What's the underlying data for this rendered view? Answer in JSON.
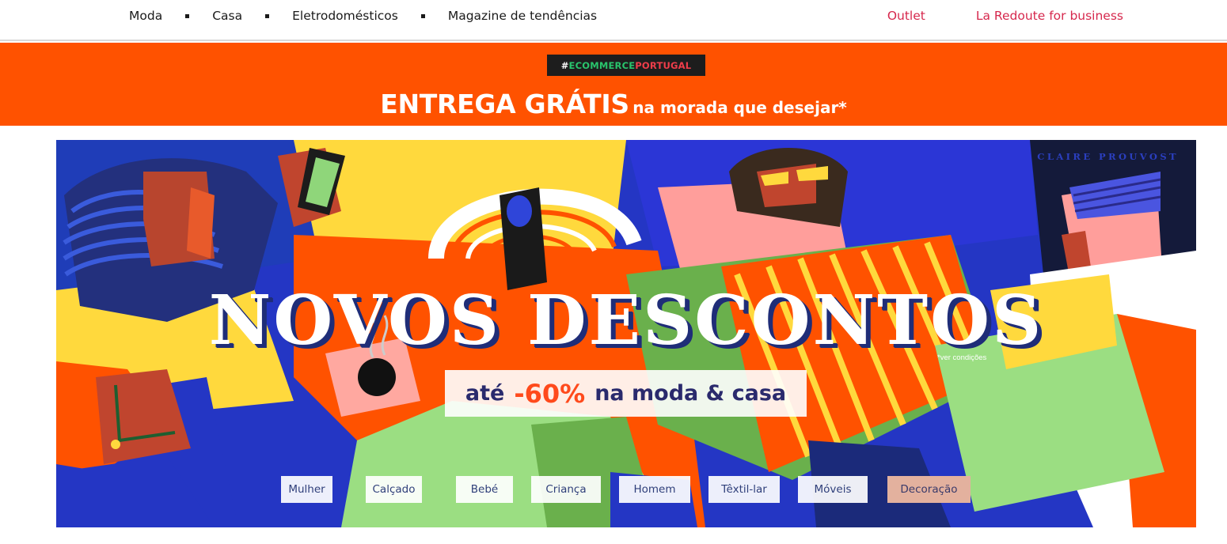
{
  "nav": {
    "main": [
      "Moda",
      "Casa",
      "Eletrodomésticos",
      "Magazine de tendências"
    ],
    "outlet": "Outlet",
    "business": "La Redoute for business"
  },
  "promo": {
    "tag_hash": "#",
    "tag_word1": "ECOMMERCE",
    "tag_word2": "PORTUGAL",
    "headline_big": "ENTREGA GRÁTIS",
    "headline_small": "na morada que desejar*"
  },
  "hero": {
    "artist": "CLAIRE PROUVOST",
    "title": "NOVOS DESCONTOS",
    "conditions": "*ver condições",
    "discount_prefix": "até",
    "discount_value": "-60%",
    "discount_suffix": "na moda & casa",
    "categories": [
      "Mulher",
      "Calçado",
      "Bebé",
      "Criança",
      "Homem",
      "Têxtil-lar",
      "Móveis",
      "Decoração"
    ]
  },
  "colors": {
    "accent": "#d6284d",
    "promo_bg": "#ff5200",
    "headline_shadow": "#1f2d78"
  }
}
